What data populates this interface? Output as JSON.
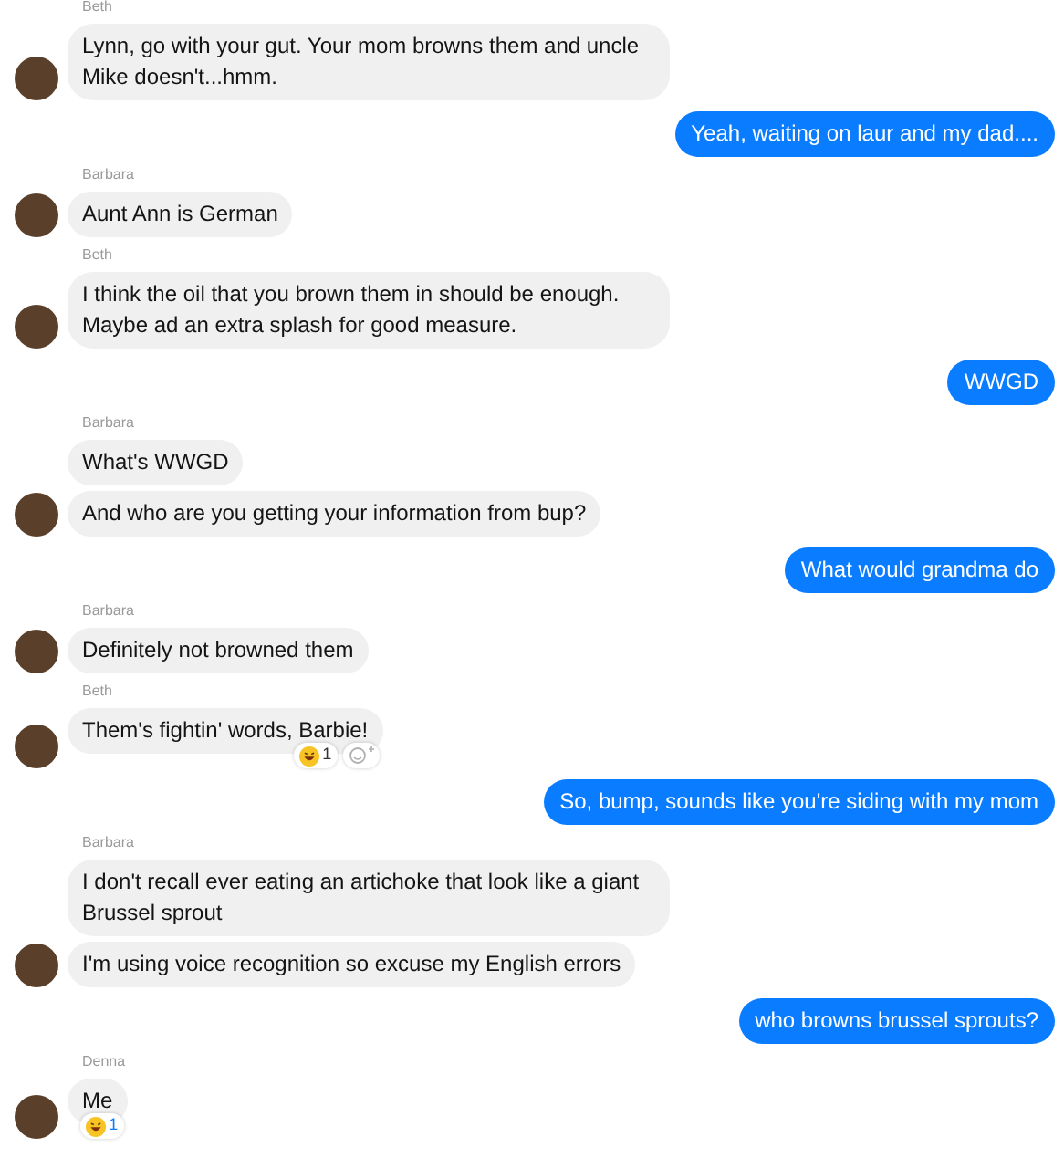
{
  "messages": [
    {
      "kind": "incoming",
      "sender": "Beth",
      "bubbles": [
        {
          "text": "Lynn,  go with your gut.  Your mom browns them and uncle Mike doesn't...hmm."
        }
      ]
    },
    {
      "kind": "outgoing",
      "text": "Yeah, waiting on laur and my dad...."
    },
    {
      "kind": "incoming",
      "sender": "Barbara",
      "bubbles": [
        {
          "text": "Aunt Ann is German"
        }
      ]
    },
    {
      "kind": "incoming",
      "sender": "Beth",
      "bubbles": [
        {
          "text": "I think the oil that you brown them in should be enough. Maybe ad an extra splash for good measure."
        }
      ]
    },
    {
      "kind": "outgoing",
      "text": "WWGD"
    },
    {
      "kind": "incoming",
      "sender": "Barbara",
      "bubbles": [
        {
          "text": "What's WWGD"
        },
        {
          "text": "And who are you getting your information from bup?"
        }
      ]
    },
    {
      "kind": "outgoing",
      "text": "What would grandma do"
    },
    {
      "kind": "incoming",
      "sender": "Barbara",
      "bubbles": [
        {
          "text": "Definitely not browned them"
        }
      ]
    },
    {
      "kind": "incoming",
      "sender": "Beth",
      "bubbles": [
        {
          "text": "Them's fightin' words, Barbie!",
          "reaction_count": "1",
          "add_reaction": true
        }
      ]
    },
    {
      "kind": "outgoing",
      "text": "So, bump, sounds like you're siding with my mom"
    },
    {
      "kind": "incoming",
      "sender": "Barbara",
      "bubbles": [
        {
          "text": "I don't recall ever eating an artichoke that look like a giant Brussel sprout"
        },
        {
          "text": "I'm using voice recognition so excuse my English errors"
        }
      ]
    },
    {
      "kind": "outgoing",
      "text": "who browns brussel sprouts?"
    },
    {
      "kind": "incoming",
      "sender": "Denna",
      "bubbles": [
        {
          "text": "Me",
          "reaction_count": "1"
        }
      ]
    }
  ]
}
